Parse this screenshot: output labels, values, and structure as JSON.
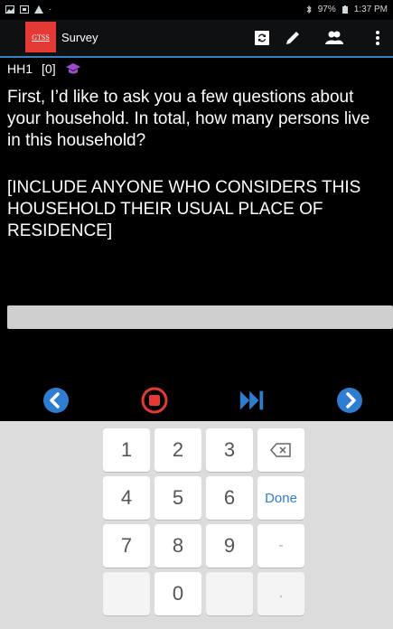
{
  "status_bar": {
    "battery": "97%",
    "time": "1:37 PM"
  },
  "action_bar": {
    "logo_text": "GTSS",
    "title": "Survey"
  },
  "question": {
    "code": "HH1",
    "index": "[0]",
    "text": "First, I’d like to ask you a few questions about your household. In total, how many persons live in this household?",
    "instruction": "[INCLUDE ANYONE WHO CONSIDERS THIS HOUSEHOLD THEIR USUAL PLACE OF RESIDENCE]"
  },
  "answer": {
    "value": ""
  },
  "keyboard": {
    "keys": {
      "k1": "1",
      "k2": "2",
      "k3": "3",
      "k4": "4",
      "k5": "5",
      "k6": "6",
      "k7": "7",
      "k8": "8",
      "k9": "9",
      "k0": "0",
      "done": "Done",
      "dash": "-",
      "dot": "."
    }
  },
  "colors": {
    "accent_blue": "#2e7dd1",
    "stop_red": "#e53935",
    "logo_red": "#e53935",
    "grad_cap_purple": "#9c4dcc"
  }
}
